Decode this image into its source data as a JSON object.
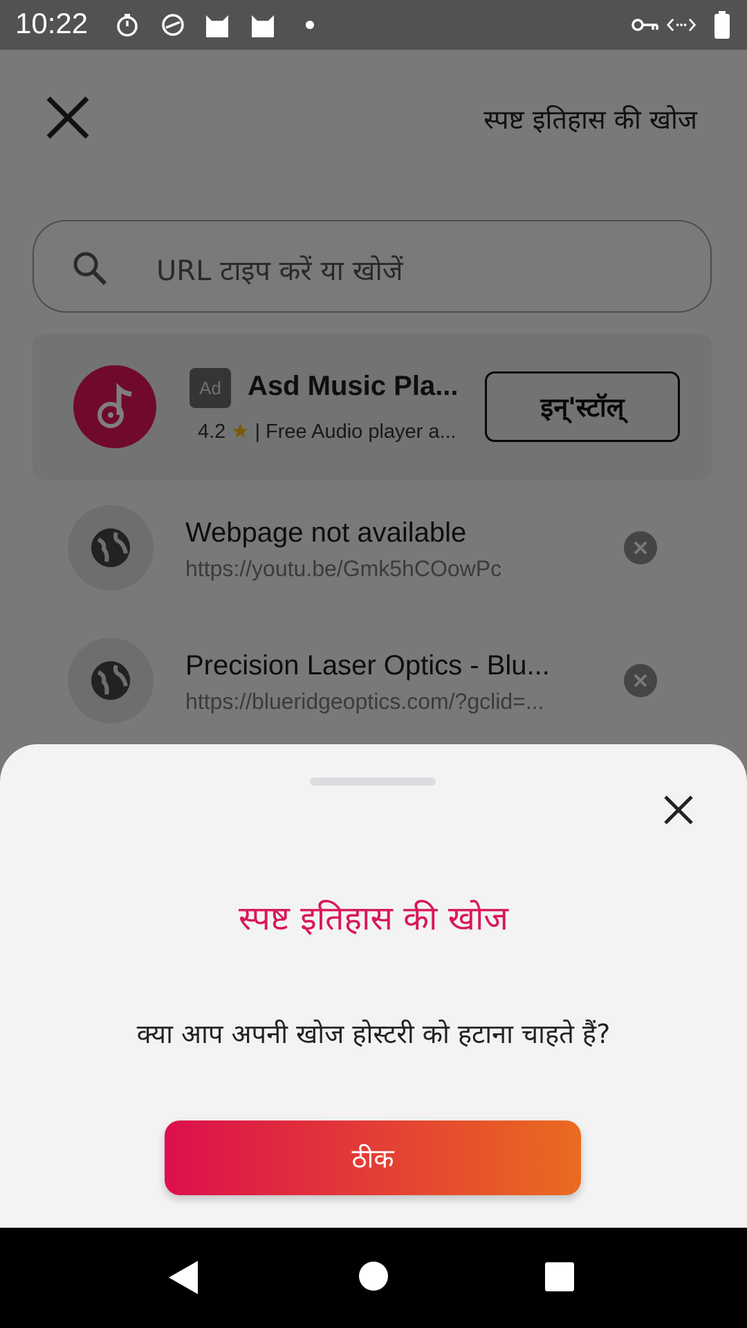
{
  "status_bar": {
    "time": "10:22",
    "icons_left": [
      "timer-icon",
      "sync-icon",
      "cat-icon",
      "cat-icon",
      "dot-icon"
    ],
    "icons_right": [
      "vpn-key-icon",
      "data-arrows-icon",
      "battery-icon"
    ]
  },
  "topbar": {
    "title": "स्पष्ट इतिहास की खोज",
    "close_icon": "close-icon"
  },
  "search": {
    "placeholder": "URL टाइप करें या खोजें"
  },
  "ad": {
    "badge": "Ad",
    "title": "Asd Music Pla...",
    "rating": "4.2",
    "subtitle": "| Free Audio player a...",
    "install_label": "इन्'स्टॉल्",
    "brand_color": "#e1155b"
  },
  "history": [
    {
      "title": "Webpage not available",
      "url": "https://youtu.be/Gmk5hCOowPc"
    },
    {
      "title": "Precision Laser Optics - Blu...",
      "url": "https://blueridgeoptics.com/?gclid=..."
    }
  ],
  "dialog": {
    "title": "स्पष्ट इतिहास की खोज",
    "message": "क्या आप अपनी खोज होस्टरी को हटाना चाहते हैं?",
    "ok_label": "ठीक",
    "accent_color": "#d9175a",
    "gradient": [
      "#dc0f4c",
      "#ea6b1f"
    ]
  },
  "nav": {
    "icons": [
      "back-icon",
      "home-icon",
      "recents-icon"
    ]
  }
}
